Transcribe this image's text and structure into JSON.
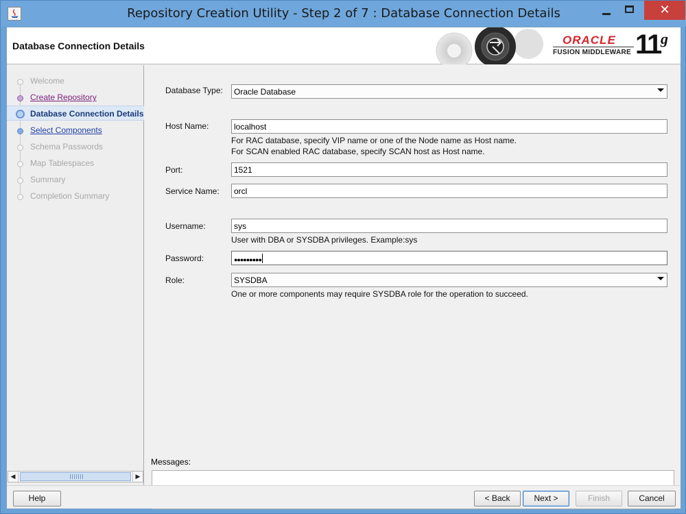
{
  "window": {
    "title": "Repository Creation Utility - Step 2 of 7 : Database Connection Details",
    "minimize_icon": "minimize-icon",
    "maximize_icon": "maximize-icon",
    "close_icon": "close-icon",
    "close_glyph": "✕"
  },
  "header": {
    "title": "Database Connection Details",
    "brand": "ORACLE",
    "product": "FUSION MIDDLEWARE",
    "release": "11",
    "release_suffix": "g"
  },
  "nav": {
    "items": [
      {
        "label": "Welcome",
        "state": "disabled"
      },
      {
        "label": "Create Repository",
        "state": "visited"
      },
      {
        "label": "Database Connection Details",
        "state": "current"
      },
      {
        "label": "Select Components",
        "state": "link"
      },
      {
        "label": "Schema Passwords",
        "state": "disabled"
      },
      {
        "label": "Map Tablespaces",
        "state": "disabled"
      },
      {
        "label": "Summary",
        "state": "disabled"
      },
      {
        "label": "Completion Summary",
        "state": "disabled"
      }
    ]
  },
  "form": {
    "db_type_label": "Database Type:",
    "db_type_value": "Oracle Database",
    "host_label": "Host Name:",
    "host_value": "localhost",
    "host_hint1": "For RAC database, specify VIP name or one of the Node name as Host name.",
    "host_hint2": "For SCAN enabled RAC database, specify SCAN host as Host name.",
    "port_label": "Port:",
    "port_value": "1521",
    "service_label": "Service Name:",
    "service_value": "orcl",
    "username_label": "Username:",
    "username_value": "sys",
    "username_hint": "User with DBA or SYSDBA privileges. Example:sys",
    "password_label": "Password:",
    "password_value": "●●●●●●●●●",
    "role_label": "Role:",
    "role_value": "SYSDBA",
    "role_hint": "One or more components may require SYSDBA role for the operation to succeed.",
    "messages_label": "Messages:"
  },
  "footer": {
    "help": "Help",
    "back": "< Back",
    "next": "Next >",
    "finish": "Finish",
    "cancel": "Cancel"
  },
  "colors": {
    "oracle_red": "#d3262d",
    "titlebar": "#6fa7dc",
    "close_button": "#c8403c",
    "current_step": "#1b3a79"
  }
}
